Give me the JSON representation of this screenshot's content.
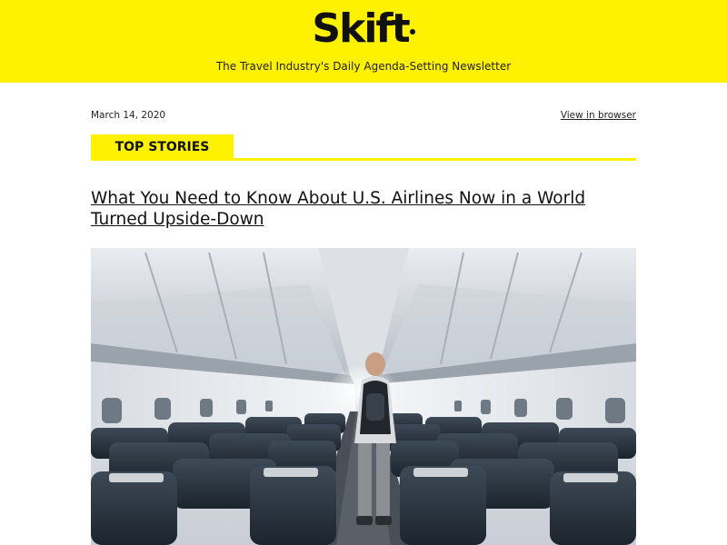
{
  "header": {
    "logo_text": "Skift",
    "tagline": "The Travel Industry's Daily Agenda-Setting Newsletter",
    "background": "#fff200"
  },
  "meta": {
    "date": "March 14, 2020",
    "view_in_browser": "View in browser"
  },
  "section": {
    "label": "TOP STORIES"
  },
  "article": {
    "headline": "What You Need to Know About U.S. Airlines Now in a World Turned Upside-Down",
    "image_alt": "Passenger with backpack walking down the aisle of an empty airplane cabin"
  }
}
